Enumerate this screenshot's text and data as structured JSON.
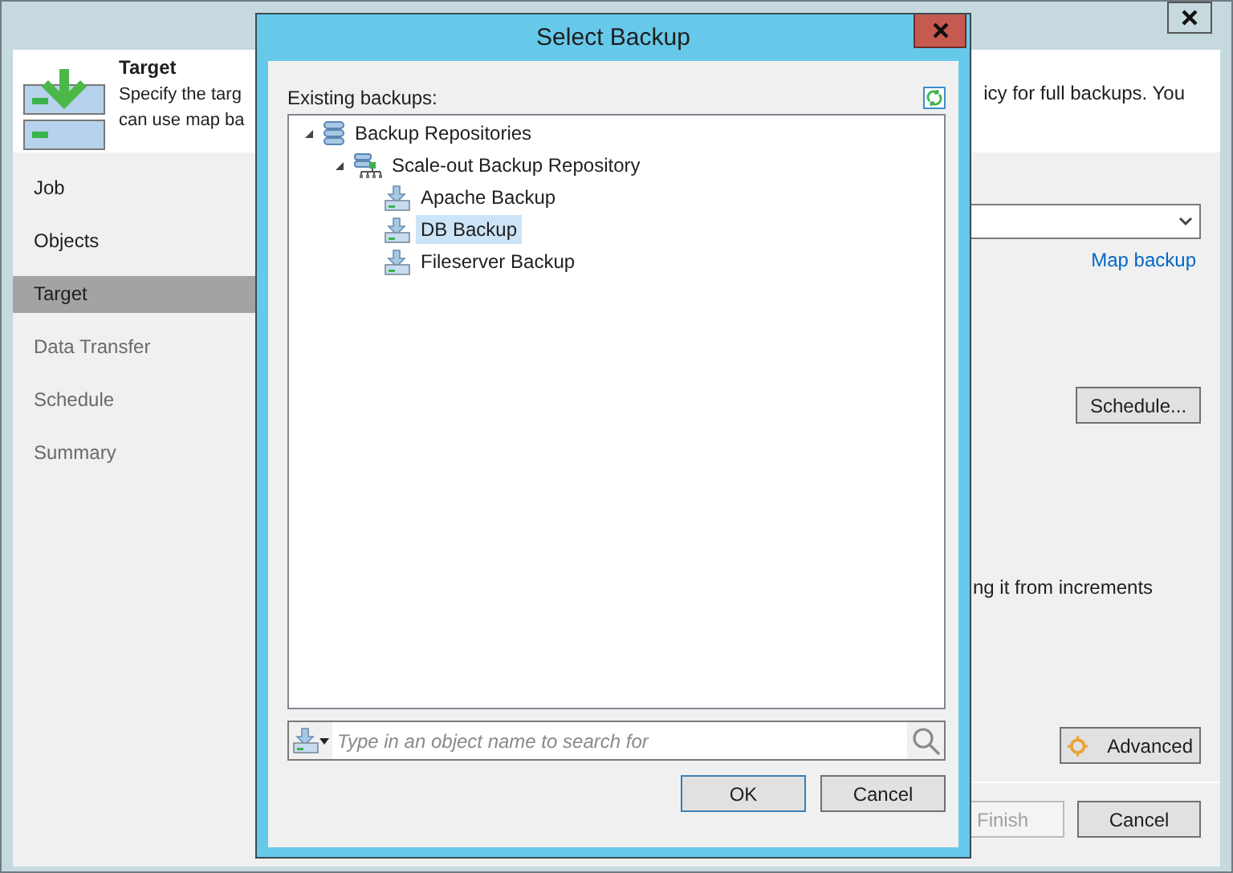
{
  "wizard": {
    "header": {
      "title": "Target",
      "description_left": [
        "Specify the targ",
        "can use map ba"
      ],
      "description_right": "icy for full backups. You"
    },
    "steps": [
      {
        "label": "Job",
        "selected": false,
        "disabled": false
      },
      {
        "label": "Objects",
        "selected": false,
        "disabled": false
      },
      {
        "label": "Target",
        "selected": true,
        "disabled": false
      },
      {
        "label": "Data Transfer",
        "selected": false,
        "disabled": true
      },
      {
        "label": "Schedule",
        "selected": false,
        "disabled": true
      },
      {
        "label": "Summary",
        "selected": false,
        "disabled": true
      }
    ],
    "map_link": "Map backup",
    "schedule_button": "Schedule...",
    "increments_text": "ng it from increments",
    "advanced_button": "Advanced",
    "footer_buttons": [
      {
        "label": "Finish",
        "disabled": true
      },
      {
        "label": "Cancel",
        "disabled": false
      }
    ]
  },
  "dialog": {
    "title": "Select Backup",
    "list_label": "Existing backups:",
    "tree": [
      {
        "label": "Backup Repositories",
        "kind": "repositories",
        "expanded": true,
        "selected": false,
        "children": [
          {
            "label": "Scale-out Backup Repository",
            "kind": "scaleout",
            "expanded": true,
            "selected": false,
            "children": [
              {
                "label": "Apache Backup",
                "kind": "backup",
                "selected": false
              },
              {
                "label": "DB Backup",
                "kind": "backup",
                "selected": true
              },
              {
                "label": "Fileserver Backup",
                "kind": "backup",
                "selected": false
              }
            ]
          }
        ]
      }
    ],
    "search": {
      "placeholder": "Type in an object name to search for"
    },
    "buttons": [
      {
        "label": "OK",
        "kind": "default"
      },
      {
        "label": "Cancel",
        "kind": "normal"
      }
    ]
  }
}
